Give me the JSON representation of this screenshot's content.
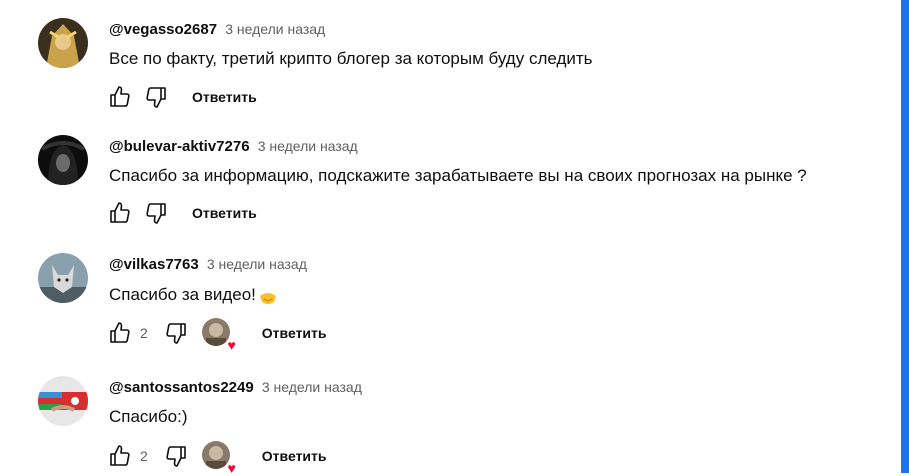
{
  "comments": [
    {
      "author": "@vegasso2687",
      "time": "3 недели назад",
      "text": "Все по факту, третий крипто блогер за которым буду следить",
      "likes": "",
      "reply_label": "Ответить",
      "avatar_icon": "anime-character-avatar"
    },
    {
      "author": "@bulevar-aktiv7276",
      "time": "3 недели назад",
      "text": "Спасибо за информацию, подскажите зарабатываете вы на своих прогнозах на рынке ?",
      "likes": "",
      "reply_label": "Ответить",
      "avatar_icon": "hooded-figure-avatar"
    },
    {
      "author": "@vilkas7763",
      "time": "3 недели назад",
      "text": "Спасибо за видео!",
      "likes": "2",
      "reply_label": "Ответить",
      "avatar_icon": "wolf-avatar",
      "text_emoji": "handshake-emoji",
      "creator_heart": true
    },
    {
      "author": "@santossantos2249",
      "time": "3 недели назад",
      "text": "Спасибо:)",
      "likes": "2",
      "reply_label": "Ответить",
      "avatar_icon": "flags-handshake-avatar",
      "creator_heart": true
    }
  ],
  "colors": {
    "scrollbar": "#1a73e8",
    "heart": "#ff0033",
    "meta_text": "#606060"
  }
}
